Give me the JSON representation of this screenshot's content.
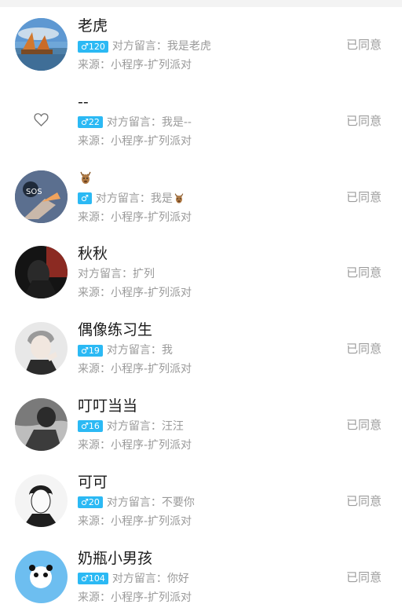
{
  "requests": [
    {
      "name": "老虎",
      "badge": "♂120",
      "message": "对方留言：我是老虎",
      "source": "来源：小程序-扩列派对",
      "status": "已同意",
      "avatar": "landscape"
    },
    {
      "name": "--",
      "badge": "♂22",
      "message": "对方留言：我是--",
      "source": "来源：小程序-扩列派对",
      "status": "已同意",
      "avatar": "heart"
    },
    {
      "name": "",
      "badge": "♂",
      "message": "对方留言：我是",
      "source": "来源：小程序-扩列派对",
      "status": "已同意",
      "avatar": "hand"
    },
    {
      "name": "秋秋",
      "badge": "",
      "message": "对方留言：扩列",
      "source": "来源：小程序-扩列派对",
      "status": "已同意",
      "avatar": "dark"
    },
    {
      "name": "偶像练习生",
      "badge": "♂19",
      "message": "对方留言：我",
      "source": "来源：小程序-扩列派对",
      "status": "已同意",
      "avatar": "anime"
    },
    {
      "name": "叮叮当当",
      "badge": "♂16",
      "message": "对方留言：汪汪",
      "source": "来源：小程序-扩列派对",
      "status": "已同意",
      "avatar": "bw"
    },
    {
      "name": "可可",
      "badge": "♂20",
      "message": "对方留言：不要你",
      "source": "来源：小程序-扩列派对",
      "status": "已同意",
      "avatar": "sketch"
    },
    {
      "name": "奶瓶小男孩",
      "badge": "♂104",
      "message": "对方留言：你好",
      "source": "来源：小程序-扩列派对",
      "status": "已同意",
      "avatar": "panda"
    }
  ],
  "icons": {
    "heart": "heart-outline-icon",
    "deer": "deer-emoji-icon"
  },
  "colors": {
    "badge": "#2bb9f4",
    "secondary": "#9a9a9a",
    "name": "#1a1a1a"
  }
}
